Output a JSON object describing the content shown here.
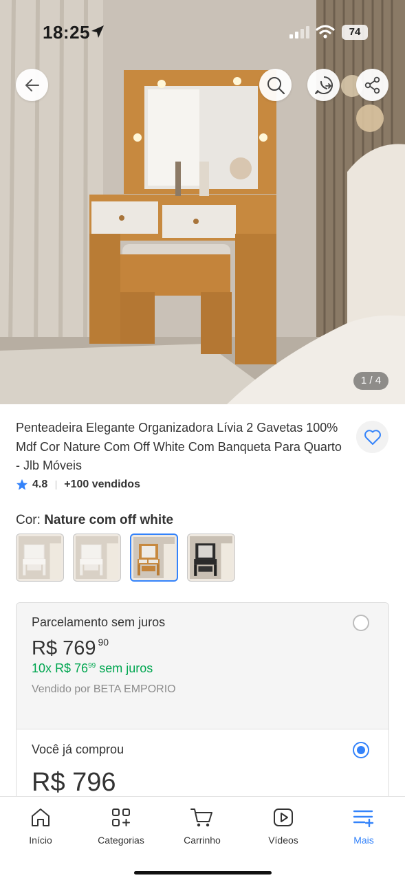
{
  "status_bar": {
    "time": "18:25",
    "battery": "74"
  },
  "gallery": {
    "counter": "1 / 4"
  },
  "product": {
    "title": "Penteadeira Elegante Organizadora Lívia 2 Gavetas 100% Mdf Cor Nature Com Off White Com Banqueta Para Quarto - Jlb Móveis",
    "rating": "4.8",
    "sold": "+100 vendidos",
    "color_label": "Cor: ",
    "color_value": "Nature com off white",
    "thumbnails": [
      {
        "variant": "white",
        "selected": false
      },
      {
        "variant": "white",
        "selected": false
      },
      {
        "variant": "nature",
        "selected": true
      },
      {
        "variant": "black",
        "selected": false
      }
    ]
  },
  "payment": {
    "option1": {
      "title": "Parcelamento sem juros",
      "price_whole": "R$ 769",
      "price_cents": "90",
      "installment_prefix": "10x R$ 76",
      "installment_cents": "99",
      "installment_suffix": " sem juros",
      "seller": "Vendido por BETA EMPORIO",
      "selected": false
    },
    "option2": {
      "title": "Você já comprou",
      "price": "R$ 796",
      "selected": true
    }
  },
  "nav": {
    "items": [
      {
        "label": "Início",
        "icon": "home-icon"
      },
      {
        "label": "Categorias",
        "icon": "categories-icon"
      },
      {
        "label": "Carrinho",
        "icon": "cart-icon"
      },
      {
        "label": "Vídeos",
        "icon": "videos-icon"
      },
      {
        "label": "Mais",
        "icon": "more-icon",
        "active": true
      }
    ]
  },
  "colors": {
    "accent": "#3483fa",
    "green": "#00a650",
    "text": "#333333"
  }
}
